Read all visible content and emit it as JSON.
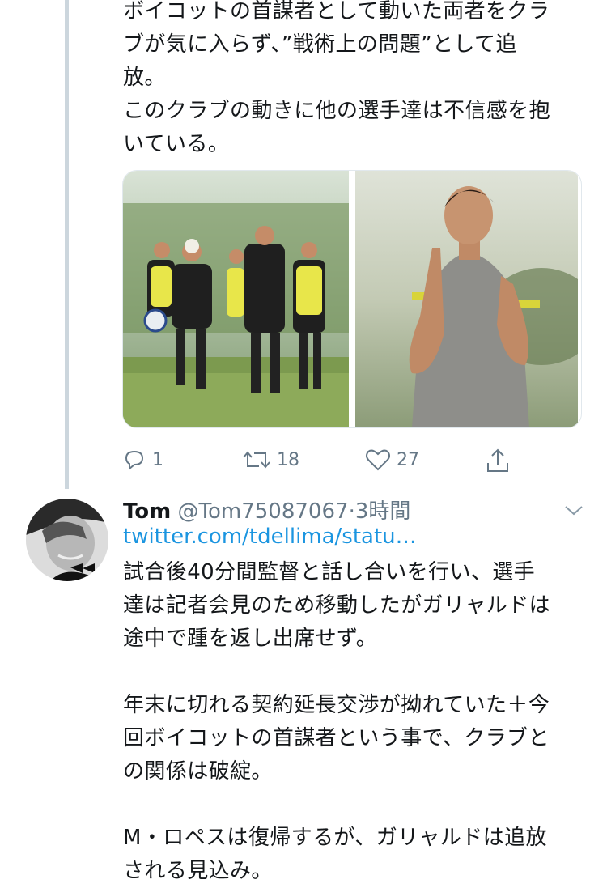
{
  "tweet1": {
    "lines": [
      "ボイコットの首謀者として動いた両者をクラ",
      "ブが気に入らず、”戦術上の問題”として追",
      "放。",
      "このクラブの動きに他の選手達は不信感を抱",
      "いている。"
    ],
    "media": [
      {
        "icon": "photo-training-kick",
        "colors": [
          "#b8c9b0",
          "#3b5a2a"
        ]
      },
      {
        "icon": "photo-player-clapping",
        "colors": [
          "#c9cfbb",
          "#7d8c70"
        ]
      }
    ],
    "actions": {
      "reply_count": "1",
      "retweet_count": "18",
      "like_count": "27"
    }
  },
  "tweet2": {
    "display_name": "Tom",
    "handle": "@Tom75087067",
    "separator": "·",
    "time": "3時間",
    "link": "twitter.com/tdellima/statu…",
    "paragraphs": [
      [
        "試合後40分間監督と話し合いを行い、選手",
        "達は記者会見のため移動したがガリャルドは",
        "途中で踵を返し出席せず。"
      ],
      [
        "年末に切れる契約延長交渉が拗れていた＋今",
        "回ボイコットの首謀者という事で、クラブと",
        "の関係は破綻。"
      ],
      [
        "M・ロペスは復帰するが、ガリャルドは追放",
        "される見込み。"
      ]
    ]
  },
  "colors": {
    "link": "#1b95e0",
    "muted": "#657786",
    "thread_line": "#ccd6dd"
  }
}
